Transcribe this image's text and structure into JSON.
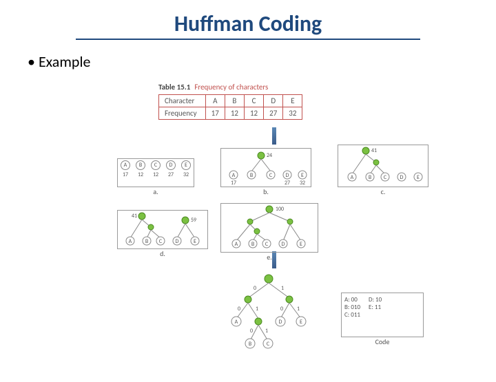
{
  "title": "Huffman Coding",
  "bullet": "Example",
  "table": {
    "caption_label": "Table 15.1",
    "caption_text": "Frequency of characters",
    "row1_label": "Character",
    "row2_label": "Frequency",
    "cols": [
      "A",
      "B",
      "C",
      "D",
      "E"
    ],
    "freqs": [
      "17",
      "12",
      "12",
      "27",
      "32"
    ]
  },
  "panels": {
    "a": {
      "label": "a.",
      "chars": [
        "A",
        "B",
        "C",
        "D",
        "E"
      ],
      "vals": [
        "17",
        "12",
        "12",
        "27",
        "32"
      ]
    },
    "b": {
      "label": "b.",
      "chars": [
        "A",
        "B",
        "C",
        "D",
        "E"
      ],
      "vals": [
        "17",
        "",
        "",
        "27",
        "32"
      ],
      "node": "24"
    },
    "c": {
      "label": "c.",
      "chars": [
        "A",
        "B",
        "C",
        "D",
        "E"
      ],
      "node": "41"
    },
    "d": {
      "label": "d.",
      "chars": [
        "A",
        "B",
        "C",
        "D",
        "E"
      ],
      "nodes": [
        "41",
        "59"
      ]
    },
    "e": {
      "label": "e.",
      "chars": [
        "A",
        "B",
        "C",
        "D",
        "E"
      ],
      "root": "100"
    },
    "f": {
      "chars": [
        "A",
        "B",
        "C",
        "D",
        "E"
      ],
      "edges": [
        "0",
        "1",
        "0",
        "1",
        "0",
        "1",
        "0",
        "1"
      ]
    }
  },
  "codes": {
    "label": "Code",
    "entries": [
      {
        "ch": "A:",
        "code": "00"
      },
      {
        "ch": "B:",
        "code": "010"
      },
      {
        "ch": "C:",
        "code": "011"
      },
      {
        "ch": "D:",
        "code": "10"
      },
      {
        "ch": "E:",
        "code": "11"
      }
    ]
  },
  "chart_data": {
    "type": "table",
    "title": "Frequency of characters",
    "categories": [
      "A",
      "B",
      "C",
      "D",
      "E"
    ],
    "values": [
      17,
      12,
      12,
      27,
      32
    ],
    "huffman_codes": {
      "A": "00",
      "B": "010",
      "C": "011",
      "D": "10",
      "E": "11"
    },
    "tree_steps": [
      {
        "step": "a",
        "forest": [
          {
            "A": 17
          },
          {
            "B": 12
          },
          {
            "C": 12
          },
          {
            "D": 27
          },
          {
            "E": 32
          }
        ]
      },
      {
        "step": "b",
        "merged": {
          "value": 24,
          "children": [
            "B",
            "C"
          ]
        }
      },
      {
        "step": "c",
        "merged": {
          "value": 41,
          "children": [
            "A",
            24
          ]
        }
      },
      {
        "step": "d",
        "merged": [
          {
            "value": 41
          },
          {
            "value": 59,
            "children": [
              "D",
              "E"
            ]
          }
        ]
      },
      {
        "step": "e",
        "root": {
          "value": 100,
          "children": [
            41,
            59
          ]
        }
      }
    ]
  }
}
